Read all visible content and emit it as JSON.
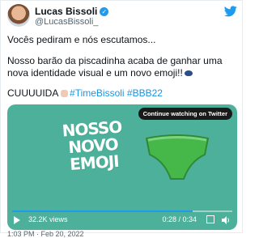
{
  "author": {
    "name": "Lucas Bissoli",
    "handle": "@LucasBissoli_"
  },
  "tweet": {
    "line1": "Vocês pediram e nós escutamos...",
    "line2": "Nosso barão da piscadinha acaba de ganhar uma nova identidade visual e um novo emoji!!",
    "line3_prefix": "CUUUUIDA",
    "hashtags": "#TimeBissoli #BBB22"
  },
  "media": {
    "continue_label": "Continue watching on Twitter",
    "big_text_lines": [
      "NOSSO",
      "NOVO",
      "EMOJI"
    ],
    "views": "32.2K views",
    "time": "0:28 / 0:34",
    "progress": 0.82
  },
  "footer": {
    "timestamp": "1:03 PM · Feb 20, 2022"
  },
  "icons": {
    "verified": "verified-badge-icon",
    "twitter": "twitter-bird-icon",
    "play": "play-icon",
    "fullscreen": "fullscreen-icon",
    "volume": "volume-icon"
  },
  "colors": {
    "accent": "#1d9bf0",
    "media_bg": "#4db09a",
    "underwear": "#46b84a"
  }
}
